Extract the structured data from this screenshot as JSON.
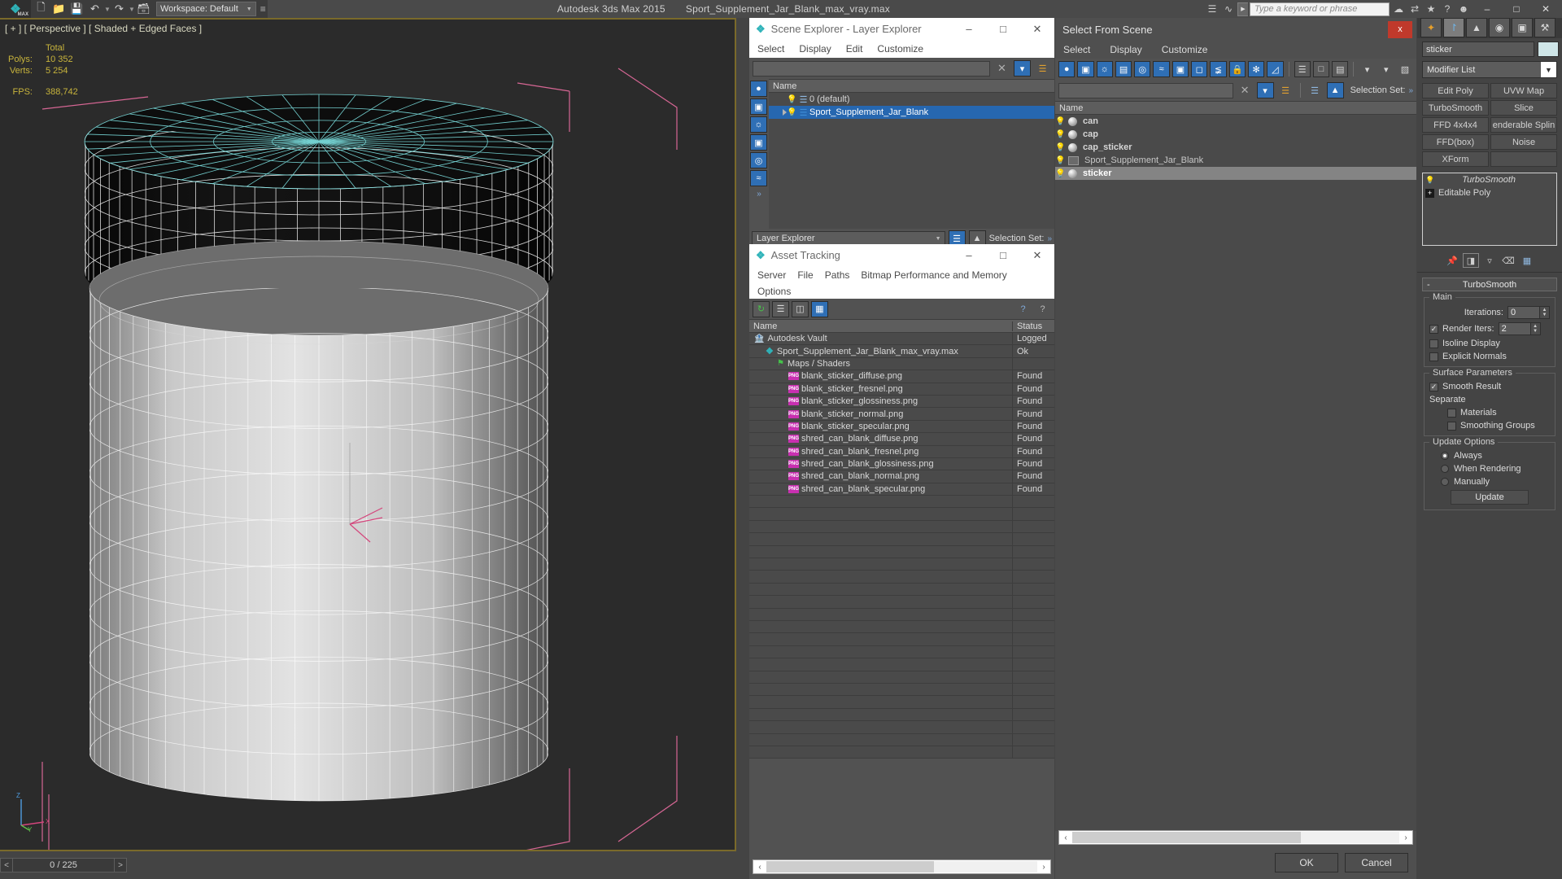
{
  "titlebar": {
    "logo_text": "MAX",
    "quick_icons": [
      "new-icon",
      "open-icon",
      "save-icon",
      "undo-icon",
      "redo-icon",
      "set-project-icon"
    ],
    "workspace_label": "Workspace: Default",
    "app_title": "Autodesk 3ds Max  2015",
    "file_title": "Sport_Supplement_Jar_Blank_max_vray.max",
    "search_placeholder": "Type a keyword or phrase",
    "window_buttons": [
      "minimize",
      "maximize",
      "close"
    ]
  },
  "viewport": {
    "label": "[ + ] [ Perspective ] [ Shaded + Edged Faces ]",
    "stats": {
      "total_header": "Total",
      "polys_label": "Polys:",
      "polys_value": "10 352",
      "verts_label": "Verts:",
      "verts_value": "5 254",
      "fps_label": "FPS:",
      "fps_value": "388,742"
    },
    "axis": {
      "z": "Z",
      "y": "Y",
      "x": "X"
    }
  },
  "statusbar": {
    "prev_frame": "<",
    "frame_indicator": "0 / 225",
    "next_frame": ">"
  },
  "scene_explorer": {
    "title": "Scene Explorer - Layer Explorer",
    "menu": [
      "Select",
      "Display",
      "Edit",
      "Customize"
    ],
    "filter_value": "",
    "columns": [
      "Name"
    ],
    "rows": [
      {
        "name": "0 (default)",
        "selected": false,
        "expandable": false
      },
      {
        "name": "Sport_Supplement_Jar_Blank",
        "selected": true,
        "expandable": true
      }
    ],
    "mode_label": "Layer Explorer",
    "selection_set_label": "Selection Set:",
    "side_icons": [
      "geometry-icon",
      "shapes-icon",
      "lights-icon",
      "cameras-icon",
      "helpers-icon",
      "spacewarps-icon"
    ]
  },
  "asset_tracking": {
    "title": "Asset Tracking",
    "menu": [
      "Server",
      "File",
      "Paths",
      "Bitmap Performance and Memory",
      "Options"
    ],
    "toolbar_icons": [
      "refresh-icon",
      "list-icon",
      "paths-icon",
      "grid-icon",
      "help-icon",
      "help2-icon"
    ],
    "columns": {
      "name": "Name",
      "status": "Status"
    },
    "rows": [
      {
        "name": "Autodesk Vault",
        "status": "Logged",
        "icon": "vault-icon",
        "indent": 0
      },
      {
        "name": "Sport_Supplement_Jar_Blank_max_vray.max",
        "status": "Ok",
        "icon": "max-file-icon",
        "indent": 1
      },
      {
        "name": "Maps / Shaders",
        "status": "",
        "icon": "maps-icon",
        "indent": 2
      },
      {
        "name": "blank_sticker_diffuse.png",
        "status": "Found",
        "icon": "png-icon",
        "indent": 3
      },
      {
        "name": "blank_sticker_fresnel.png",
        "status": "Found",
        "icon": "png-icon",
        "indent": 3
      },
      {
        "name": "blank_sticker_glossiness.png",
        "status": "Found",
        "icon": "png-icon",
        "indent": 3
      },
      {
        "name": "blank_sticker_normal.png",
        "status": "Found",
        "icon": "png-icon",
        "indent": 3
      },
      {
        "name": "blank_sticker_specular.png",
        "status": "Found",
        "icon": "png-icon",
        "indent": 3
      },
      {
        "name": "shred_can_blank_diffuse.png",
        "status": "Found",
        "icon": "png-icon",
        "indent": 3
      },
      {
        "name": "shred_can_blank_fresnel.png",
        "status": "Found",
        "icon": "png-icon",
        "indent": 3
      },
      {
        "name": "shred_can_blank_glossiness.png",
        "status": "Found",
        "icon": "png-icon",
        "indent": 3
      },
      {
        "name": "shred_can_blank_normal.png",
        "status": "Found",
        "icon": "png-icon",
        "indent": 3
      },
      {
        "name": "shred_can_blank_specular.png",
        "status": "Found",
        "icon": "png-icon",
        "indent": 3
      }
    ],
    "empty_row_count": 21
  },
  "select_from_scene": {
    "title": "Select From Scene",
    "close_label": "x",
    "menu": [
      "Select",
      "Display",
      "Customize"
    ],
    "filter_value": "",
    "selection_set_label": "Selection Set:",
    "columns": [
      "Name"
    ],
    "rows": [
      {
        "name": "can",
        "selected": false,
        "bold": true,
        "icon": "sphere-icon"
      },
      {
        "name": "cap",
        "selected": false,
        "bold": true,
        "icon": "sphere-icon"
      },
      {
        "name": "cap_sticker",
        "selected": false,
        "bold": true,
        "icon": "sphere-icon"
      },
      {
        "name": "Sport_Supplement_Jar_Blank",
        "selected": false,
        "bold": false,
        "icon": "group-icon"
      },
      {
        "name": "sticker",
        "selected": true,
        "bold": true,
        "icon": "sphere-icon"
      }
    ],
    "ok_label": "OK",
    "cancel_label": "Cancel"
  },
  "command_panel": {
    "tabs": [
      "create-icon",
      "modify-icon",
      "hierarchy-icon",
      "motion-icon",
      "display-icon",
      "utilities-icon"
    ],
    "active_tab_index": 1,
    "object_name": "sticker",
    "object_color": "#cfe6e8",
    "modifier_list_label": "Modifier List",
    "modifier_buttons": [
      "Edit Poly",
      "UVW Map",
      "TurboSmooth",
      "Slice",
      "FFD 4x4x4",
      "enderable Splin",
      "FFD(box)",
      "Noise",
      "XForm",
      ""
    ],
    "stack": [
      {
        "name": "TurboSmooth",
        "italic": true,
        "expandable": false
      },
      {
        "name": "Editable Poly",
        "italic": false,
        "expandable": true
      }
    ],
    "stack_buttons": [
      "pin-stack-icon",
      "show-end-result-icon",
      "make-unique-icon",
      "remove-modifier-icon",
      "configure-sets-icon"
    ],
    "rollout": {
      "title": "TurboSmooth",
      "collapse_glyph": "-",
      "groups": [
        {
          "title": "Main",
          "fields": [
            {
              "type": "spinner",
              "label": "Iterations:",
              "value": "0"
            },
            {
              "type": "check_spinner",
              "label": "Render Iters:",
              "value": "2",
              "checked": true
            },
            {
              "type": "checkbox",
              "label": "Isoline Display",
              "checked": false
            },
            {
              "type": "checkbox",
              "label": "Explicit Normals",
              "checked": false
            }
          ]
        },
        {
          "title": "Surface Parameters",
          "fields": [
            {
              "type": "checkbox",
              "label": "Smooth Result",
              "checked": true
            },
            {
              "type": "text",
              "label": "Separate"
            },
            {
              "type": "checkbox",
              "label": "Materials",
              "checked": false,
              "indent": true
            },
            {
              "type": "checkbox",
              "label": "Smoothing Groups",
              "checked": false,
              "indent": true
            }
          ]
        },
        {
          "title": "Update Options",
          "fields": [
            {
              "type": "radio",
              "label": "Always",
              "checked": true
            },
            {
              "type": "radio",
              "label": "When Rendering",
              "checked": false
            },
            {
              "type": "radio",
              "label": "Manually",
              "checked": false
            },
            {
              "type": "button",
              "label": "Update"
            }
          ]
        }
      ]
    }
  }
}
